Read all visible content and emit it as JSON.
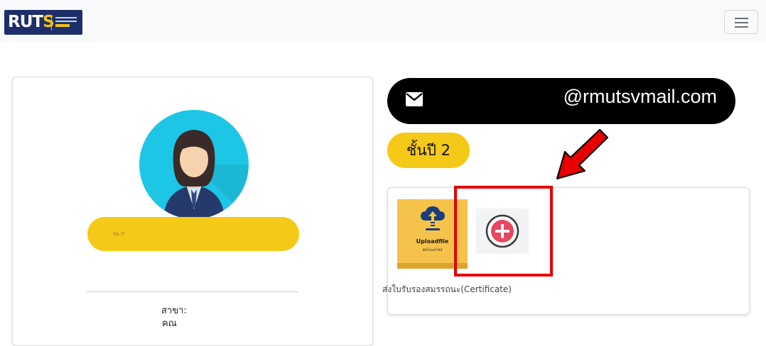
{
  "navbar": {
    "logo_text_left": "RUT",
    "logo_text_right": "S",
    "menu_icon": "hamburger-icon"
  },
  "profile": {
    "name_scribble": "ณ.ก",
    "department_label": "สาขา:",
    "department_value": "คณ",
    "avatar_icon": "female-avatar-icon"
  },
  "contact": {
    "email": "@rmutsvmail.com",
    "email_icon": "envelope-icon"
  },
  "year": {
    "label": "ชั้นปี 2"
  },
  "certificate": {
    "upload_title": "Uploadfile",
    "upload_subtitle": "อัพโหลดไฟล์",
    "upload_icon": "cloud-upload-icon",
    "add_icon": "plus-circle-icon",
    "label": "ส่งใบรับรองสมรรถนะ(Certificate)"
  },
  "annotation": {
    "highlight_color": "#e60000",
    "arrow_icon": "red-arrow-icon"
  },
  "colors": {
    "accent_yellow": "#f5c917",
    "navy": "#1d2f6a",
    "add_pink": "#e8475f"
  }
}
